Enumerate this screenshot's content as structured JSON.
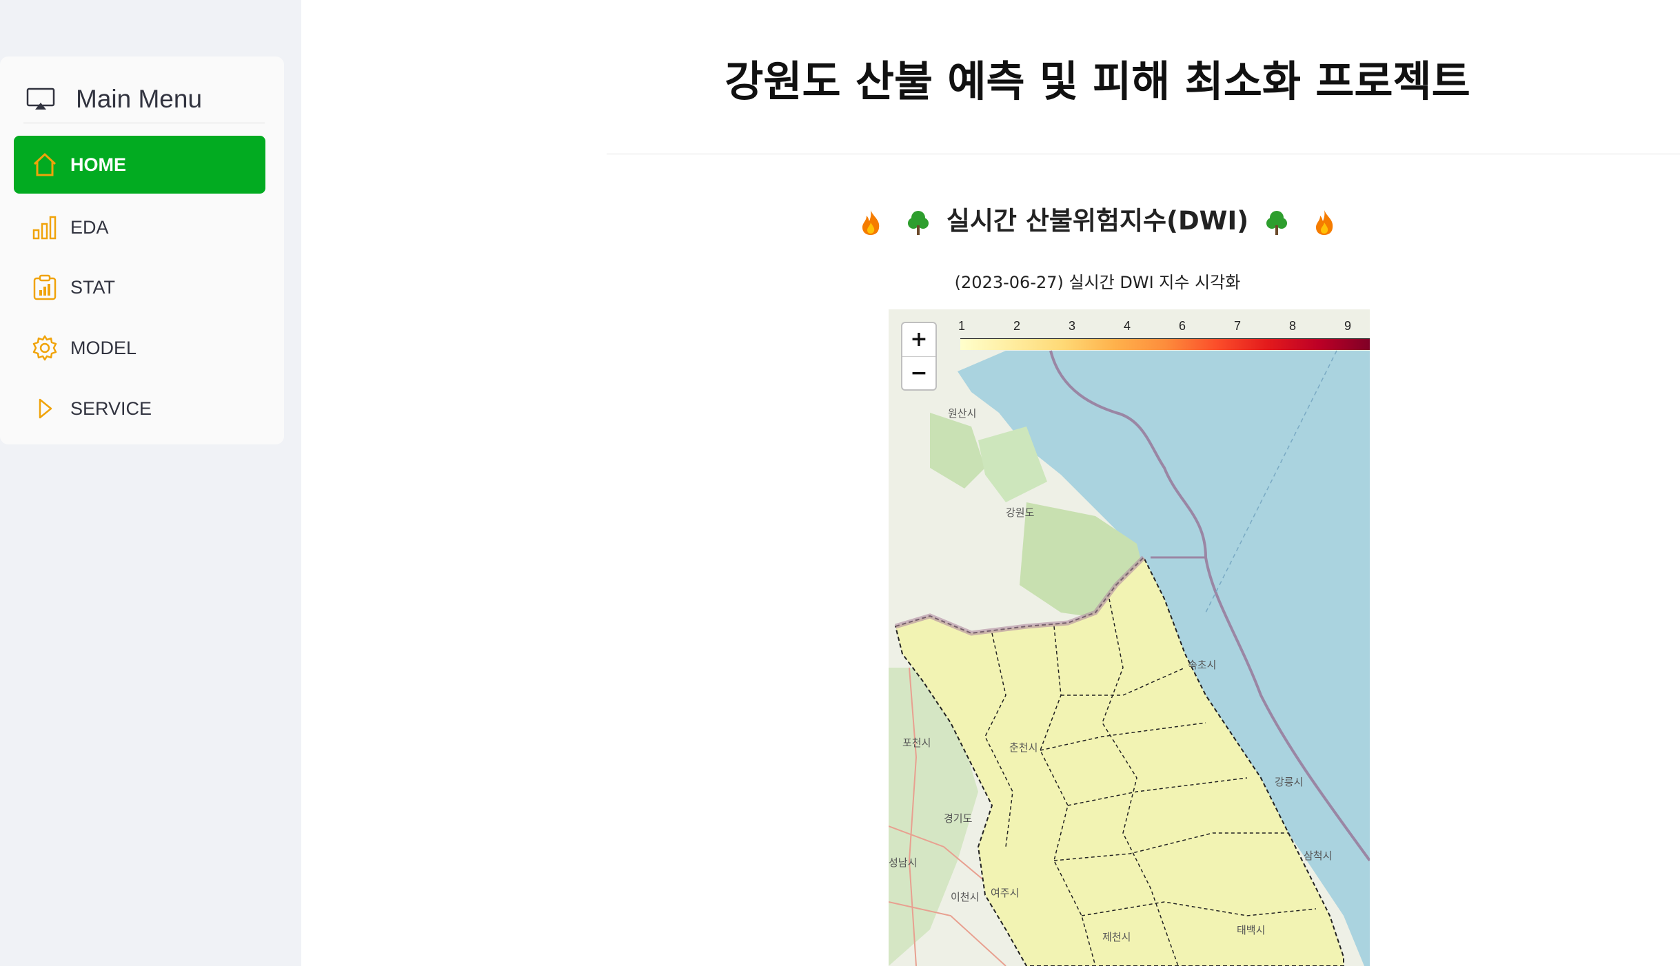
{
  "sidebar": {
    "menu_title": "Main Menu",
    "items": [
      {
        "label": "HOME",
        "active": true
      },
      {
        "label": "EDA",
        "active": false
      },
      {
        "label": "STAT",
        "active": false
      },
      {
        "label": "MODEL",
        "active": false
      },
      {
        "label": "SERVICE",
        "active": false
      }
    ],
    "active_color": "#02ab21",
    "icon_color": "#f0a30a"
  },
  "main": {
    "title": "강원도 산불 예측 및 피해 최소화 프로젝트",
    "subtitle": "실시간 산불위험지수(DWI)",
    "caption": "(2023-06-27) 실시간 DWI 지수 시각화"
  },
  "map": {
    "zoom_in": "+",
    "zoom_out": "−",
    "legend_ticks": [
      "1",
      "2",
      "3",
      "4",
      "6",
      "7",
      "8",
      "9"
    ],
    "legend_colors": [
      "#ffffcc",
      "#ffeda0",
      "#fed976",
      "#feb24c",
      "#fd8d3c",
      "#fc4e2a",
      "#e31a1c",
      "#bd0026",
      "#800026"
    ],
    "place_labels": [
      "원산시",
      "강원도",
      "포천시",
      "경기도",
      "성남시",
      "이천시",
      "여주시",
      "제천시",
      "춘천시",
      "속초시",
      "강릉시",
      "삼척시",
      "태백시"
    ]
  }
}
